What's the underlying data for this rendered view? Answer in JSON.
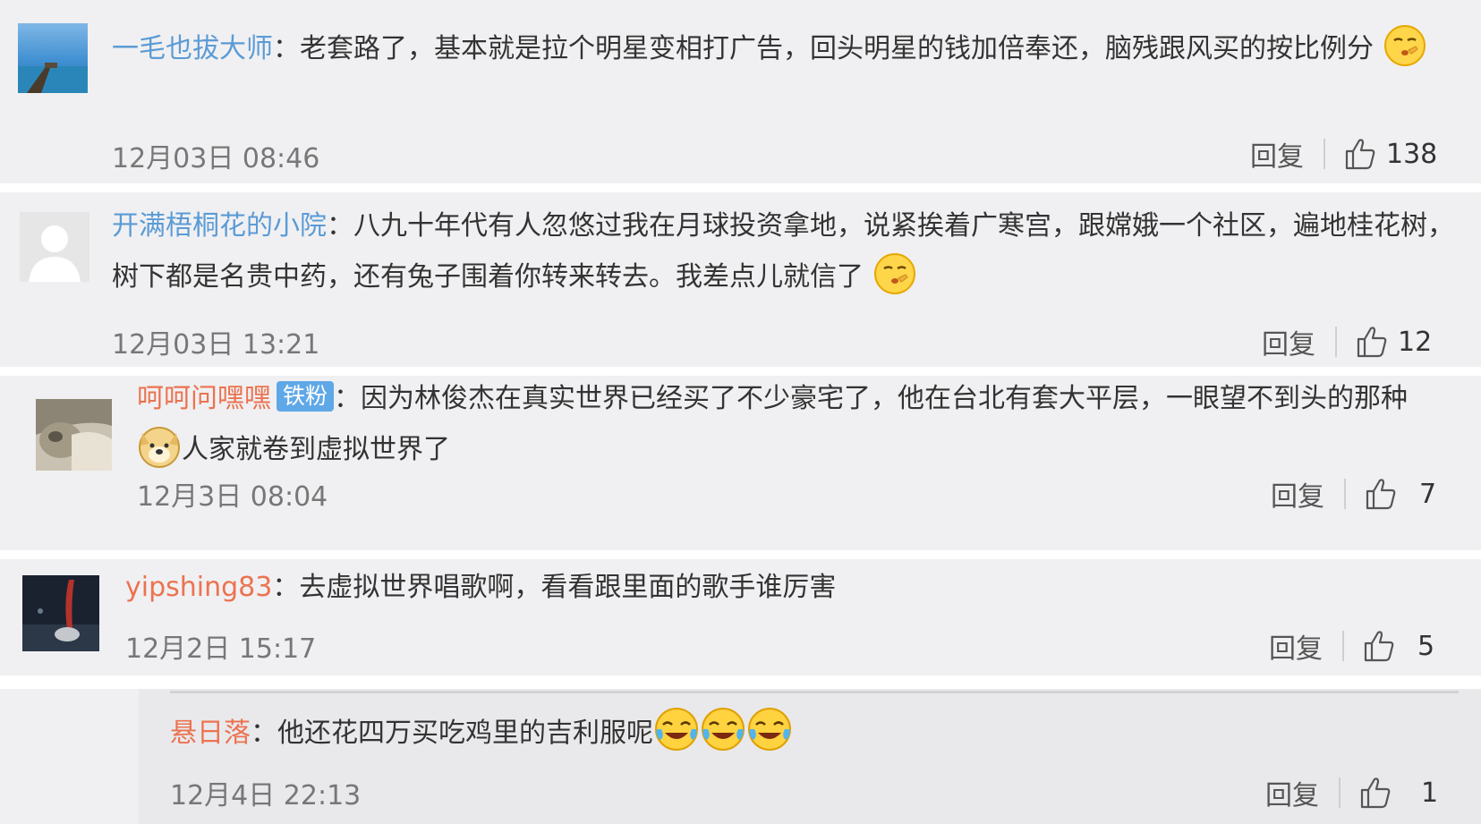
{
  "comments": [
    {
      "user": "一毛也拔大师",
      "sep": "：",
      "text": "老套路了，基本就是拉个明星变相打广告，回头明星的钱加倍奉还，脑残跟风买的按比例分",
      "time": "12月03日 08:46",
      "reply": "回复",
      "likes": "138"
    },
    {
      "user": "开满梧桐花的小院",
      "sep": "：",
      "text": "八九十年代有人忽悠过我在月球投资拿地，说紧挨着广寒宫，跟嫦娥一个社区，遍地桂花树，树下都是名贵中药，还有兔子围着你转来转去。我差点儿就信了",
      "time": "12月03日 13:21",
      "reply": "回复",
      "likes": "12"
    },
    {
      "user": "呵呵问嘿嘿",
      "badge": "铁粉",
      "sep": "：",
      "text_a": "因为林俊杰在真实世界已经买了不少豪宅了，他在台北有套大平层，一眼望不到头的那种",
      "text_b": "人家就卷到虚拟世界了",
      "time": "12月3日 08:04",
      "reply": "回复",
      "likes": "7"
    },
    {
      "user": "yipshing83",
      "sep": "：",
      "text": "去虚拟世界唱歌啊，看看跟里面的歌手谁厉害",
      "time": "12月2日 15:17",
      "reply": "回复",
      "likes": "5"
    }
  ],
  "subreply": {
    "user": "悬日落",
    "sep": "：",
    "text": "他还花四万买吃鸡里的吉利服呢",
    "time": "12月4日 22:13",
    "reply": "回复",
    "likes": "1"
  },
  "colors": {
    "username_blue": "#5b9bd5",
    "username_orange": "#eb7350",
    "badge_blue": "#5fa8e7",
    "background": "#f0f0f2"
  },
  "icons": [
    "shush-emoji",
    "doge-emoji",
    "laugh-cry-emoji",
    "thumbs-up-icon"
  ]
}
